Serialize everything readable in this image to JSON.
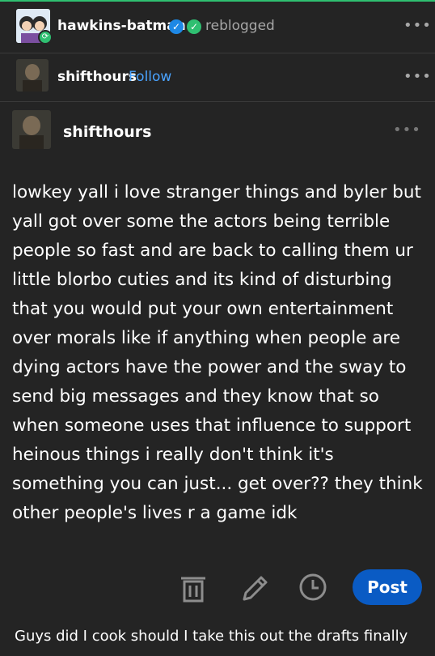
{
  "reblog_header": {
    "username": "hawkins-batman",
    "action": "reblogged",
    "more_icon": "more-horizontal-icon",
    "badge_colors": {
      "blue": "#1e88e5",
      "green": "#2fbf71"
    }
  },
  "source_header": {
    "username": "shifthours",
    "follow_label": "Follow"
  },
  "post": {
    "author": "shifthours",
    "body_lines": [
      "lowkey yall i love stranger things and byler but",
      "yall got over some the actors being terrible",
      "people so fast and are back to calling them ur",
      "little blorbo cuties and its kind of disturbing",
      "that you would put your own entertainment",
      "over morals like if anything when people are",
      "dying actors have the power and the sway to",
      "send big messages and they know that so",
      "when someone uses that influence to support",
      "heinous things i really don't think it's",
      "something you can just... get over?? they think",
      "other people's lives r a game idk"
    ]
  },
  "toolbar": {
    "delete_icon": "trash-icon",
    "edit_icon": "pencil-icon",
    "queue_icon": "clock-icon",
    "post_label": "Post",
    "accent": "#0a5bc4"
  },
  "caption": "Guys did I cook should I take this out the drafts finally"
}
